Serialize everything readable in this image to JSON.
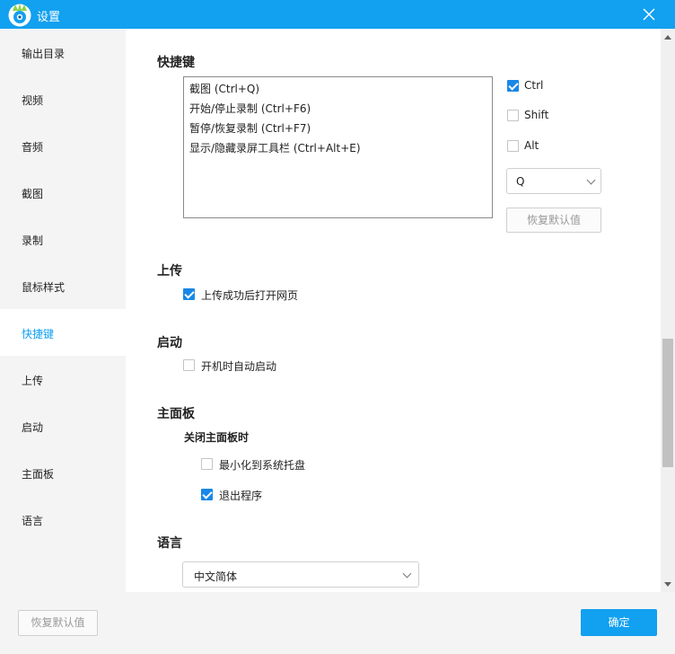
{
  "window": {
    "title": "设置",
    "accent_color": "#12a0f0",
    "icons": {
      "app": "app-logo-icon",
      "close": "close-icon"
    }
  },
  "sidebar": {
    "active_index": 6,
    "items": [
      {
        "label": "输出目录"
      },
      {
        "label": "视频"
      },
      {
        "label": "音频"
      },
      {
        "label": "截图"
      },
      {
        "label": "录制"
      },
      {
        "label": "鼠标样式"
      },
      {
        "label": "快捷键"
      },
      {
        "label": "上传"
      },
      {
        "label": "启动"
      },
      {
        "label": "主面板"
      },
      {
        "label": "语言"
      }
    ]
  },
  "hotkeys": {
    "title": "快捷键",
    "list": [
      "截图 (Ctrl+Q)",
      "开始/停止录制  (Ctrl+F6)",
      "暂停/恢复录制  (Ctrl+F7)",
      "显示/隐藏录屏工具栏  (Ctrl+Alt+E)"
    ],
    "modifiers": {
      "ctrl": {
        "label": "Ctrl",
        "checked": true
      },
      "shift": {
        "label": "Shift",
        "checked": false
      },
      "alt": {
        "label": "Alt",
        "checked": false
      }
    },
    "key_select": {
      "value": "Q"
    },
    "restore_button": "恢复默认值"
  },
  "upload": {
    "title": "上传",
    "open_page": {
      "label": "上传成功后打开网页",
      "checked": true
    }
  },
  "startup": {
    "title": "启动",
    "auto_start": {
      "label": "开机时自动启动",
      "checked": false
    }
  },
  "main_panel": {
    "title": "主面板",
    "close_label": "关闭主面板时",
    "minimize": {
      "label": "最小化到系统托盘",
      "checked": false
    },
    "exit": {
      "label": "退出程序",
      "checked": true
    }
  },
  "language": {
    "title": "语言",
    "select": {
      "value": "中文简体"
    }
  },
  "footer": {
    "restore_all": "恢复默认值",
    "ok": "确定"
  }
}
